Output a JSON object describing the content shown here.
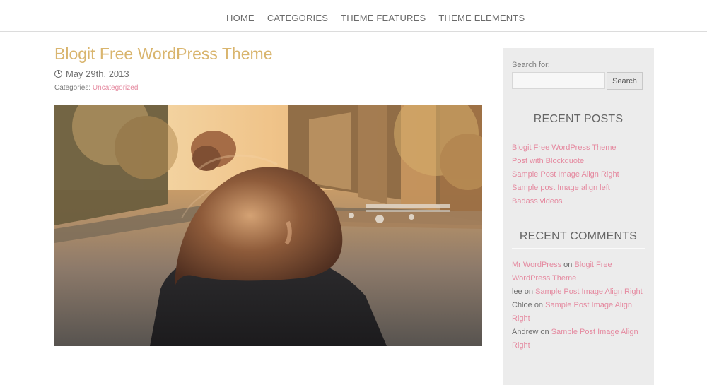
{
  "nav": {
    "items": [
      "HOME",
      "CATEGORIES",
      "THEME FEATURES",
      "THEME ELEMENTS"
    ]
  },
  "post": {
    "title": "Blogit Free WordPress Theme",
    "date": "May 29th, 2013",
    "categories_label": "Categories:",
    "category": "Uncategorized"
  },
  "sidebar": {
    "search_label": "Search for:",
    "search_button": "Search",
    "recent_posts_title": "RECENT POSTS",
    "recent_posts": [
      "Blogit Free WordPress Theme",
      "Post with Blockquote",
      "Sample Post Image Align Right",
      "Sample post Image align left",
      "Badass videos"
    ],
    "recent_comments_title": "RECENT COMMENTS",
    "recent_comments": [
      {
        "author": "Mr WordPress",
        "on": "on",
        "post": "Blogit Free WordPress Theme"
      },
      {
        "author": "lee",
        "on": "on",
        "post": "Sample Post Image Align Right"
      },
      {
        "author": "Chloe",
        "on": "on",
        "post": "Sample Post Image Align Right"
      },
      {
        "author": "Andrew",
        "on": "on",
        "post": "Sample Post Image Align Right"
      }
    ]
  },
  "colors": {
    "accent_title": "#d9b56e",
    "link_pink": "#e58aa0",
    "sidebar_bg": "#ececec",
    "text_gray": "#6e6e6e"
  }
}
